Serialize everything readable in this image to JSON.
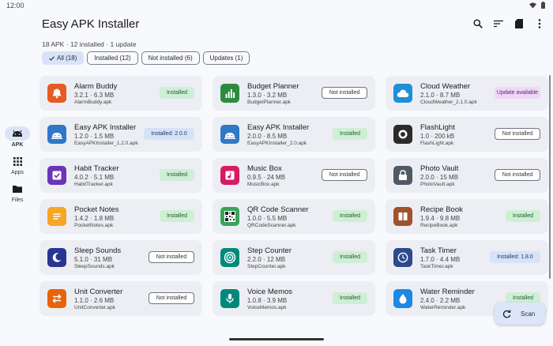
{
  "status": {
    "time": "12:00"
  },
  "nav": {
    "items": [
      {
        "label": "APK",
        "icon": "android-icon"
      },
      {
        "label": "Apps",
        "icon": "grid-icon"
      },
      {
        "label": "Files",
        "icon": "folder-icon"
      }
    ]
  },
  "header": {
    "title": "Easy APK Installer",
    "summary": "18 APK · 12 installed · 1 update"
  },
  "filters": {
    "all": "All (18)",
    "installed": "Installed (12)",
    "not_installed": "Not installed (6)",
    "updates": "Updates (1)"
  },
  "apps": [
    {
      "name": "Alarm Buddy",
      "meta": "3.2.1 · 6.3 MB",
      "file": "AlarmBuddy.apk",
      "badge": "Installed",
      "icon_color": "#e65a24"
    },
    {
      "name": "Budget Planner",
      "meta": "1.3.0 · 3.2 MB",
      "file": "BudgetPlanner.apk",
      "badge": "Not installed",
      "icon_color": "#2e8b3e"
    },
    {
      "name": "Cloud Weather",
      "meta": "2.1.0 · 8.7 MB",
      "file": "CloudWeather_2.1.0.apk",
      "badge": "Update available",
      "icon_color": "#1f8fd6"
    },
    {
      "name": "Easy APK Installer",
      "meta": "1.2.0 · 1.5 MB",
      "file": "EasyAPKInstaller_1.2.0.apk",
      "badge": "Installed: 2.0.0",
      "icon_color": "#2f78c8"
    },
    {
      "name": "Easy APK Installer",
      "meta": "2.0.0 · 8.5 MB",
      "file": "EasyAPKInstaller_2.0.apk",
      "badge": "Installed",
      "icon_color": "#2f78c8"
    },
    {
      "name": "FlashLight",
      "meta": "1.0 · 200 kB",
      "file": "FlashLight.apk",
      "badge": "Not installed",
      "icon_color": "#2b2b2b"
    },
    {
      "name": "Habit Tracker",
      "meta": "4.0.2 · 5.1 MB",
      "file": "HabitTracker.apk",
      "badge": "Installed",
      "icon_color": "#6a35b8"
    },
    {
      "name": "Music Box",
      "meta": "0.9.5 · 24 MB",
      "file": "MusicBox.apk",
      "badge": "Not installed",
      "icon_color": "#d81b60"
    },
    {
      "name": "Photo Vault",
      "meta": "2.0.0 · 15 MB",
      "file": "PhotoVault.apk",
      "badge": "Not installed",
      "icon_color": "#505a66"
    },
    {
      "name": "Pocket Notes",
      "meta": "1.4.2 · 1.8 MB",
      "file": "PocketNotes.apk",
      "badge": "Installed",
      "icon_color": "#f5a623"
    },
    {
      "name": "QR Code Scanner",
      "meta": "1.0.0 · 5.5 MB",
      "file": "QRCodeScanner.apk",
      "badge": "Installed",
      "icon_color": "#3aa35a"
    },
    {
      "name": "Recipe Book",
      "meta": "1.9.4 · 9.8 MB",
      "file": "RecipeBook.apk",
      "badge": "Installed",
      "icon_color": "#a0522d"
    },
    {
      "name": "Sleep Sounds",
      "meta": "5.1.0 · 31 MB",
      "file": "SleepSounds.apk",
      "badge": "Not installed",
      "icon_color": "#283593"
    },
    {
      "name": "Step Counter",
      "meta": "2.2.0 · 12 MB",
      "file": "StepCounter.apk",
      "badge": "Installed",
      "icon_color": "#00897b"
    },
    {
      "name": "Task Timer",
      "meta": "1.7.0 · 4.4 MB",
      "file": "TaskTimer.apk",
      "badge": "Installed: 1.8.0",
      "icon_color": "#2c4a8c"
    },
    {
      "name": "Unit Converter",
      "meta": "1.1.0 · 2.6 MB",
      "file": "UnitConverter.apk",
      "badge": "Not installed",
      "icon_color": "#e8630a"
    },
    {
      "name": "Voice Memos",
      "meta": "1.0.8 · 3.9 MB",
      "file": "VoiceMemos.apk",
      "badge": "Installed",
      "icon_color": "#00897b"
    },
    {
      "name": "Water Reminder",
      "meta": "2.4.0 · 2.2 MB",
      "file": "WaterReminder.apk",
      "badge": "Installed",
      "icon_color": "#1e88e5"
    }
  ],
  "fab": {
    "label": "Scan"
  }
}
